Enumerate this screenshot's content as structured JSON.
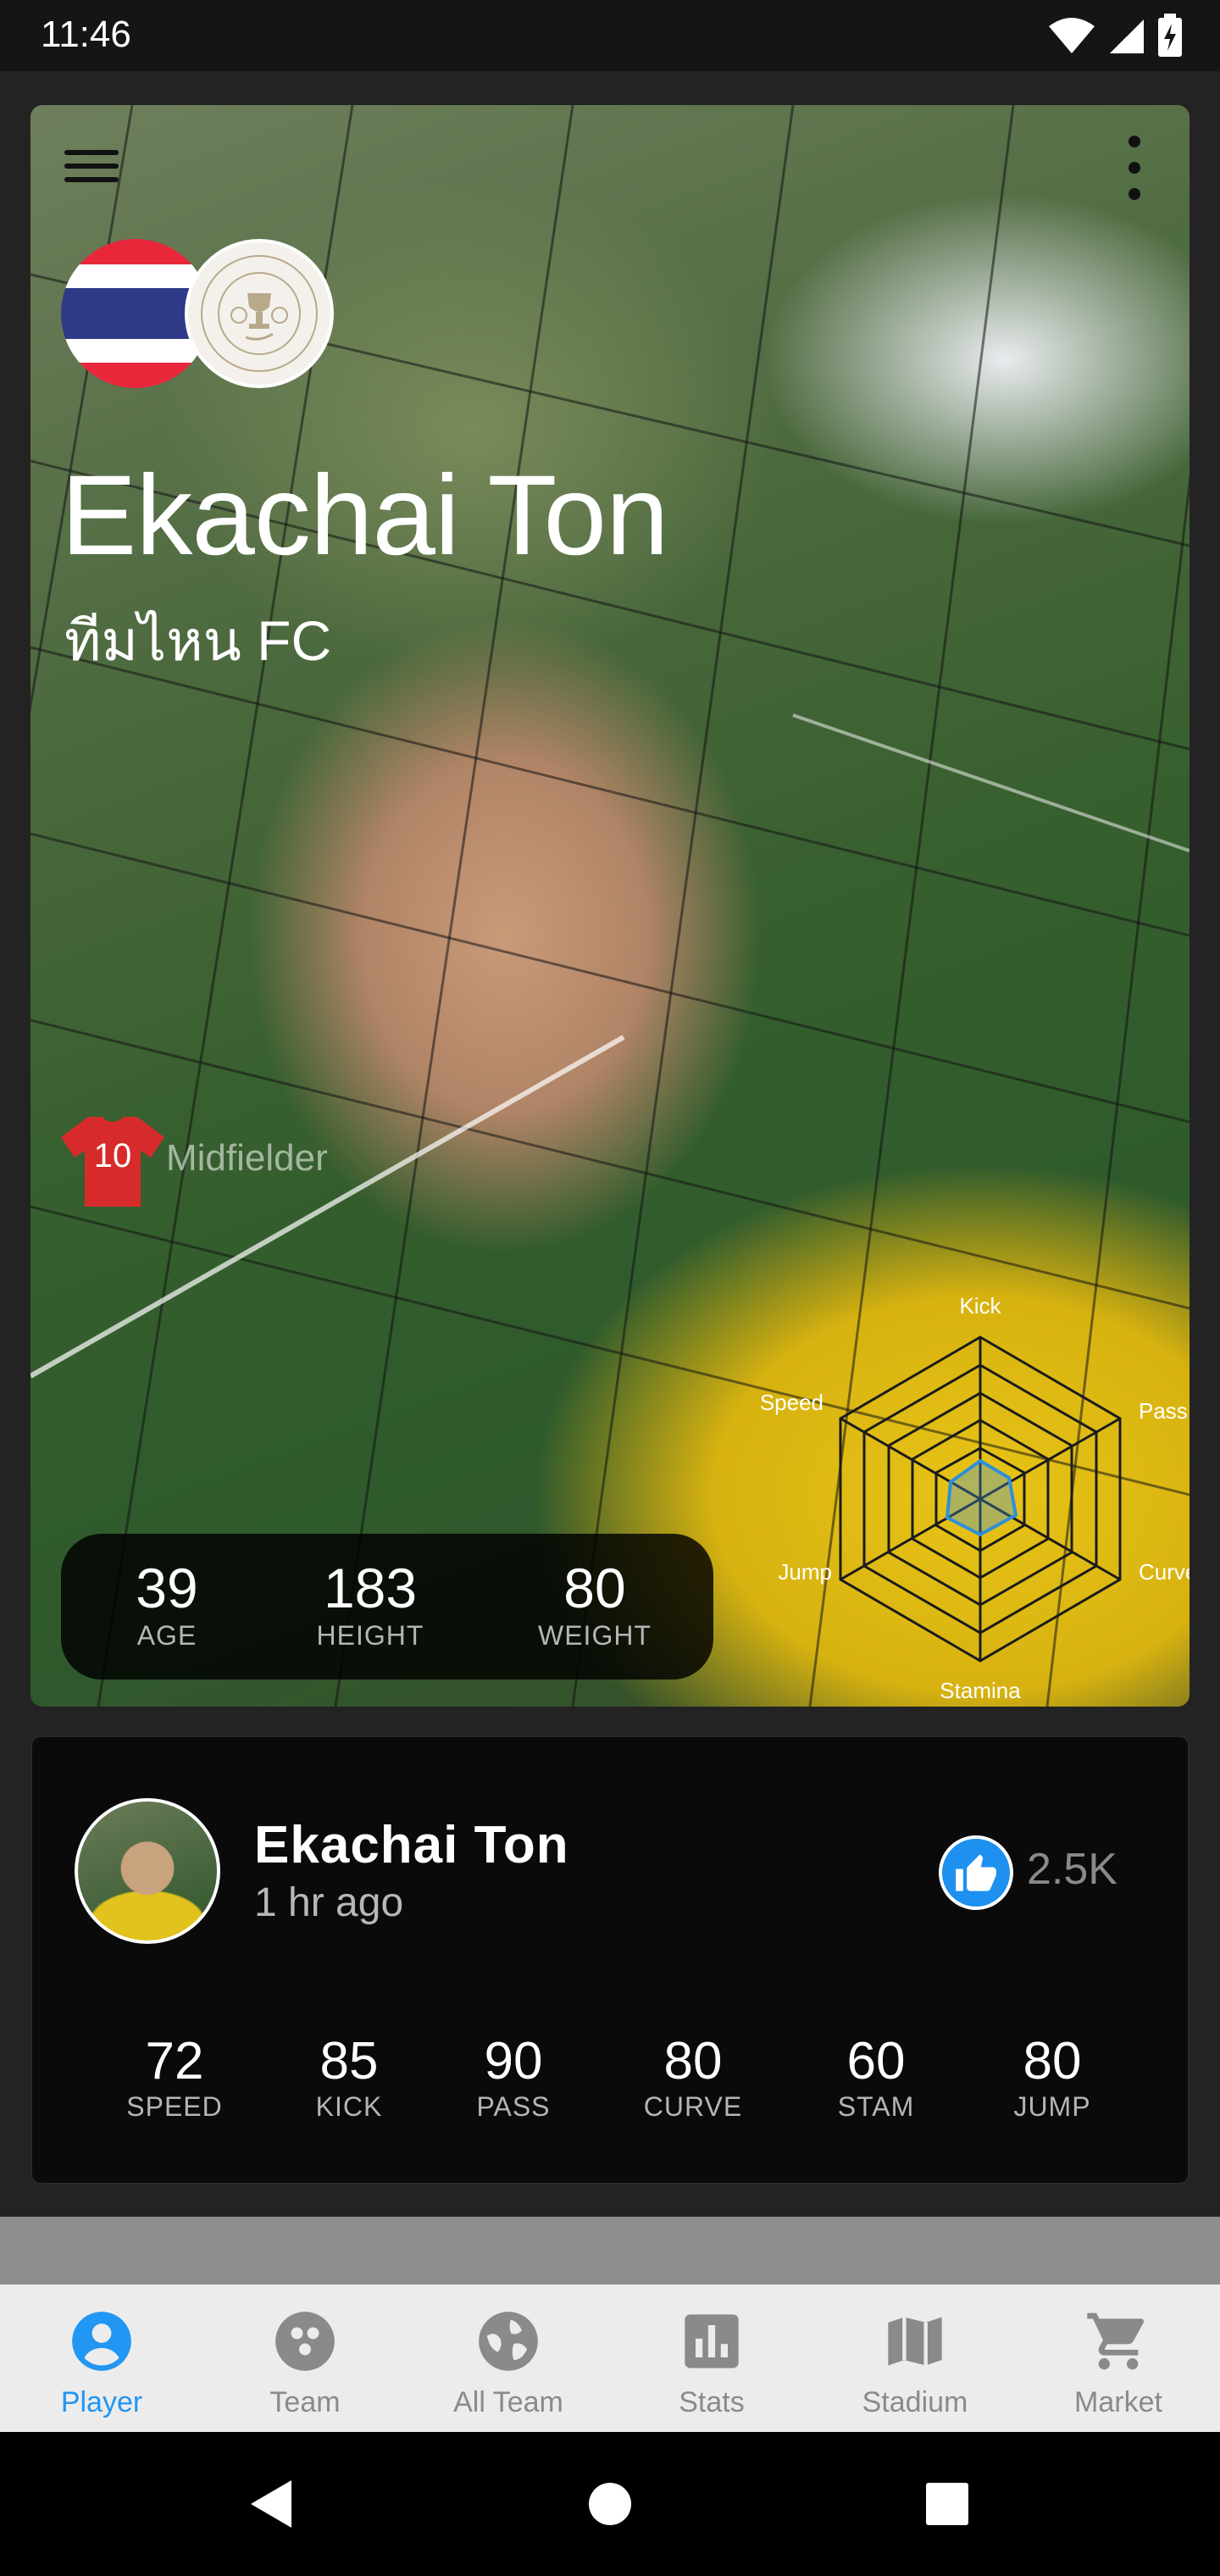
{
  "status_bar": {
    "time": "11:46"
  },
  "hero": {
    "player_name": "Ekachai Ton",
    "team_name": "ทีมไหน FC",
    "jersey_number": "10",
    "position": "Midfielder",
    "radar": {
      "labels": {
        "kick": "Kick",
        "pass": "Pass",
        "curve": "Curve",
        "stamina": "Stamina",
        "jump": "Jump",
        "speed": "Speed"
      }
    },
    "info": {
      "age_value": "39",
      "age_label": "AGE",
      "height_value": "183",
      "height_label": "HEIGHT",
      "weight_value": "80",
      "weight_label": "WEIGHT"
    }
  },
  "detail": {
    "name": "Ekachai Ton",
    "time_ago": "1 hr ago",
    "likes": "2.5K",
    "stats": [
      {
        "value": "72",
        "label": "SPEED"
      },
      {
        "value": "85",
        "label": "KICK"
      },
      {
        "value": "90",
        "label": "PASS"
      },
      {
        "value": "80",
        "label": "CURVE"
      },
      {
        "value": "60",
        "label": "STAM"
      },
      {
        "value": "80",
        "label": "JUMP"
      }
    ]
  },
  "bottom_nav": {
    "items": [
      {
        "label": "Player",
        "icon": "person-icon"
      },
      {
        "label": "Team",
        "icon": "team-icon"
      },
      {
        "label": "All Team",
        "icon": "globe-icon"
      },
      {
        "label": "Stats",
        "icon": "stats-icon"
      },
      {
        "label": "Stadium",
        "icon": "map-icon"
      },
      {
        "label": "Market",
        "icon": "cart-icon"
      }
    ],
    "active_color": "#2196f3",
    "inactive_color": "#8a8a8a"
  }
}
